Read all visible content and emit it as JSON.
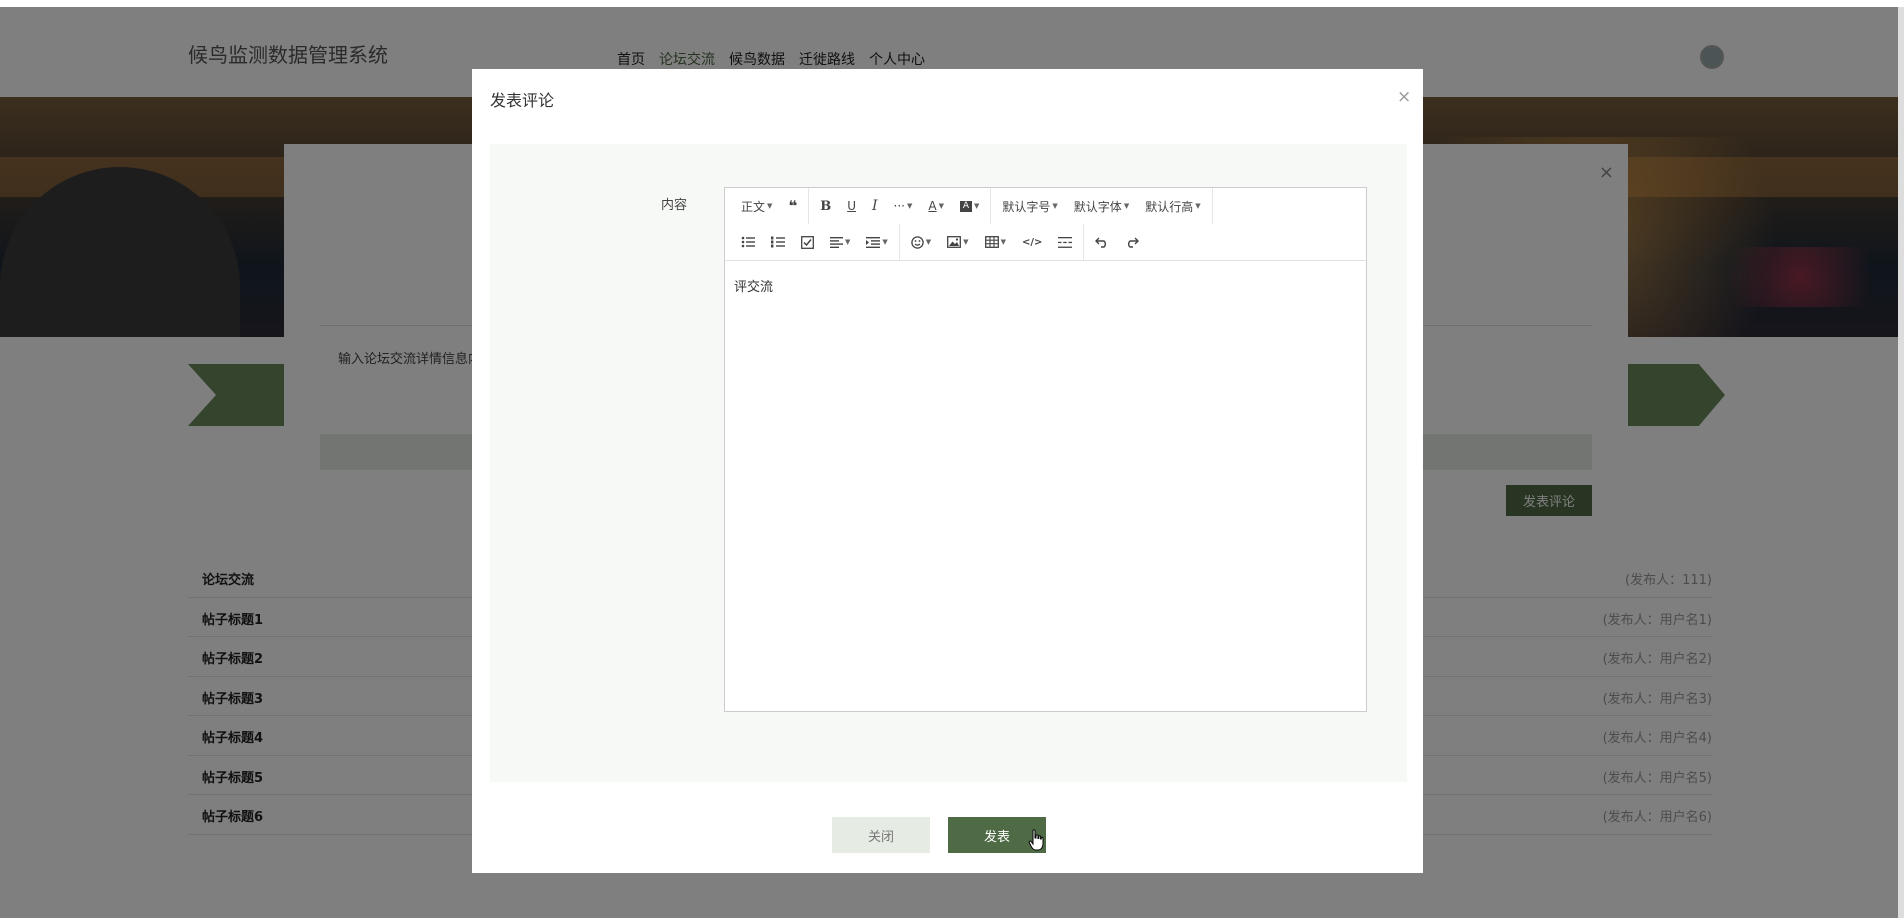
{
  "header": {
    "site_title": "候鸟监测数据管理系统",
    "nav": [
      "首页",
      "论坛交流",
      "候鸟数据",
      "迁徙路线",
      "个人中心"
    ]
  },
  "background_form": {
    "input_text": "输入论坛交流详情信息内",
    "publish_label": "发表评论"
  },
  "posts": [
    {
      "title": "论坛交流",
      "author": "(发布人：111)"
    },
    {
      "title": "帖子标题1",
      "author": "(发布人：用户名1)"
    },
    {
      "title": "帖子标题2",
      "author": "(发布人：用户名2)"
    },
    {
      "title": "帖子标题3",
      "author": "(发布人：用户名3)"
    },
    {
      "title": "帖子标题4",
      "author": "(发布人：用户名4)"
    },
    {
      "title": "帖子标题5",
      "author": "(发布人：用户名5)"
    },
    {
      "title": "帖子标题6",
      "author": "(发布人：用户名6)"
    }
  ],
  "modal": {
    "title": "发表评论",
    "close_symbol": "×",
    "content_label": "内容",
    "editor": {
      "toolbar": {
        "paragraph": "正文",
        "font_size": "默认字号",
        "font_family": "默认字体",
        "line_height": "默认行高",
        "bold": "B",
        "underline": "U",
        "italic": "I",
        "more": "···",
        "font_color": "A",
        "code": "</>"
      },
      "content": "评交流"
    },
    "close_button": "关闭",
    "publish_button": "发表"
  },
  "background_modal": {
    "close_symbol": "×"
  }
}
